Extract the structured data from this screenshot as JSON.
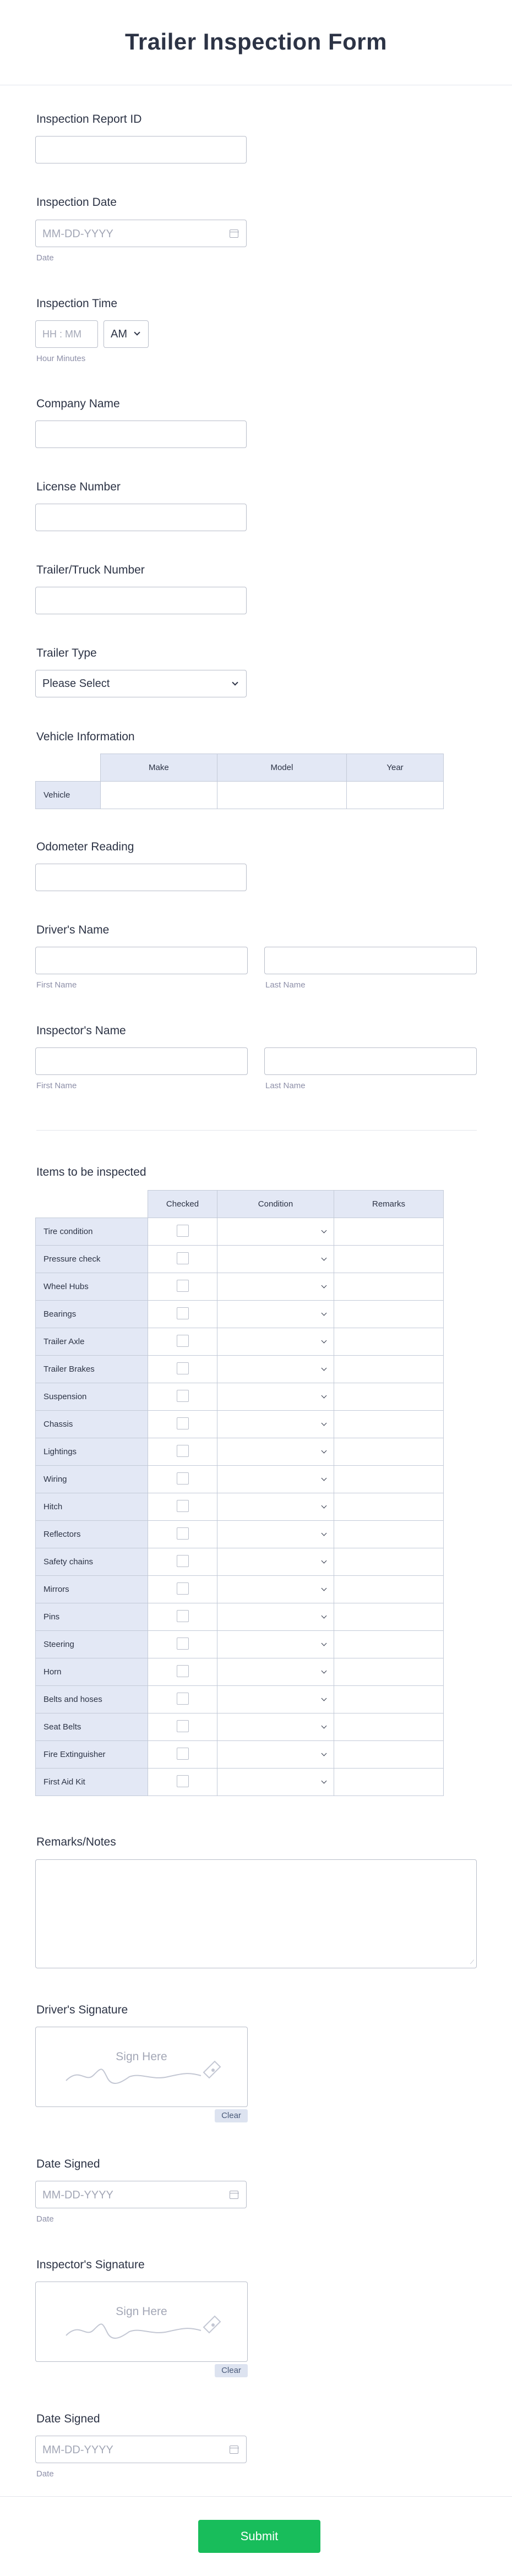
{
  "form": {
    "title": "Trailer Inspection Form",
    "submit_label": "Submit"
  },
  "fields": {
    "report_id": {
      "label": "Inspection Report ID",
      "value": ""
    },
    "inspection_date": {
      "label": "Inspection Date",
      "placeholder": "MM-DD-YYYY",
      "sublabel": "Date"
    },
    "inspection_time": {
      "label": "Inspection Time",
      "placeholder": "HH : MM",
      "ampm": "AM",
      "sublabel": "Hour Minutes"
    },
    "company_name": {
      "label": "Company Name",
      "value": ""
    },
    "license_number": {
      "label": "License Number",
      "value": ""
    },
    "trailer_number": {
      "label": "Trailer/Truck Number",
      "value": ""
    },
    "trailer_type": {
      "label": "Trailer Type",
      "selected": "Please Select"
    },
    "vehicle_info": {
      "label": "Vehicle Information",
      "columns": [
        "Make",
        "Model",
        "Year"
      ],
      "row_label": "Vehicle"
    },
    "odometer": {
      "label": "Odometer Reading",
      "value": ""
    },
    "driver_name": {
      "label": "Driver's Name",
      "first_sublabel": "First Name",
      "last_sublabel": "Last Name"
    },
    "inspector_name": {
      "label": "Inspector's Name",
      "first_sublabel": "First Name",
      "last_sublabel": "Last Name"
    },
    "items": {
      "label": "Items to be inspected",
      "columns": [
        "Checked",
        "Condition",
        "Remarks"
      ],
      "rows": [
        "Tire condition",
        "Pressure check",
        "Wheel Hubs",
        "Bearings",
        "Trailer Axle",
        "Trailer Brakes",
        "Suspension",
        "Chassis",
        "Lightings",
        "Wiring",
        "Hitch",
        "Reflectors",
        "Safety chains",
        "Mirrors",
        "Pins",
        "Steering",
        "Horn",
        "Belts and hoses",
        "Seat Belts",
        "Fire Extinguisher",
        "First Aid Kit"
      ]
    },
    "remarks": {
      "label": "Remarks/Notes"
    },
    "driver_signature": {
      "label": "Driver's Signature",
      "placeholder": "Sign Here",
      "clear_label": "Clear"
    },
    "date_signed_1": {
      "label": "Date Signed",
      "placeholder": "MM-DD-YYYY",
      "sublabel": "Date"
    },
    "inspector_signature": {
      "label": "Inspector's Signature",
      "placeholder": "Sign Here",
      "clear_label": "Clear"
    },
    "date_signed_2": {
      "label": "Date Signed",
      "placeholder": "MM-DD-YYYY",
      "sublabel": "Date"
    }
  }
}
